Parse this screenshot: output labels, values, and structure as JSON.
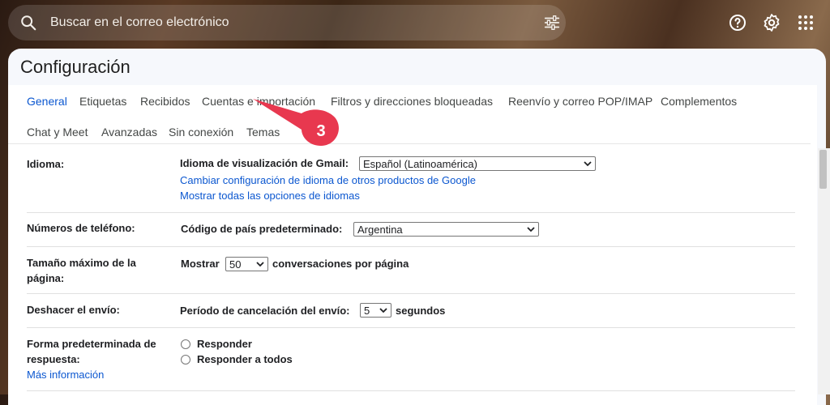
{
  "search": {
    "placeholder": "Buscar en el correo electrónico"
  },
  "page": {
    "title": "Configuración"
  },
  "tabs": [
    {
      "label": "General",
      "active": true
    },
    {
      "label": "Etiquetas"
    },
    {
      "label": "Recibidos"
    },
    {
      "label": "Cuentas e importación"
    },
    {
      "label": "Filtros y direcciones bloqueadas"
    },
    {
      "label": "Reenvío y correo POP/IMAP"
    },
    {
      "label": "Complementos"
    },
    {
      "label": "Chat y Meet"
    },
    {
      "label": "Avanzadas"
    },
    {
      "label": "Sin conexión"
    },
    {
      "label": "Temas"
    }
  ],
  "settings": {
    "language": {
      "label": "Idioma:",
      "field_label": "Idioma de visualización de Gmail:",
      "value": "Español (Latinoamérica)",
      "link1": "Cambiar configuración de idioma de otros productos de Google",
      "link2": "Mostrar todas las opciones de idiomas"
    },
    "phone": {
      "label": "Números de teléfono:",
      "field_label": "Código de país predeterminado:",
      "value": "Argentina"
    },
    "page_size": {
      "label_line1": "Tamaño máximo de la",
      "label_line2": "página:",
      "prefix": "Mostrar",
      "value": "50",
      "suffix": "conversaciones por página"
    },
    "undo_send": {
      "label": "Deshacer el envío:",
      "field_label": "Período de cancelación del envío:",
      "value": "5",
      "suffix": "segundos"
    },
    "reply": {
      "label_line1": "Forma predeterminada de",
      "label_line2": "respuesta:",
      "more_info": "Más información",
      "option1": "Responder",
      "option2": "Responder a todos"
    }
  },
  "annotation": {
    "number": "3",
    "color": "#e8384f"
  },
  "colors": {
    "accent": "#0b57d0",
    "link": "#0b57d0"
  },
  "icons": [
    "search-icon",
    "tune-icon",
    "help-icon",
    "gear-icon",
    "apps-grid-icon",
    "chevron-down-icon"
  ]
}
